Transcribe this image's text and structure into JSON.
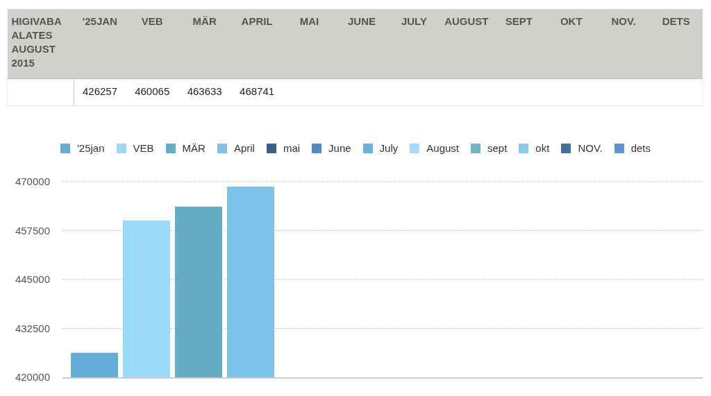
{
  "table": {
    "columns": [
      {
        "heading": "HIGIVABA ALATES AUGUST 2015"
      },
      {
        "heading": "'25JAN",
        "value": "426257"
      },
      {
        "heading": "VEB",
        "value": "460065"
      },
      {
        "heading": "MÄR",
        "value": "463633"
      },
      {
        "heading": "APRIL",
        "value": "468741"
      },
      {
        "heading": "MAI"
      },
      {
        "heading": "JUNE"
      },
      {
        "heading": "JULY"
      },
      {
        "heading": "AUGUST"
      },
      {
        "heading": "SEPT"
      },
      {
        "heading": "OKT"
      },
      {
        "heading": "NOV."
      },
      {
        "heading": "DETS"
      }
    ]
  },
  "chart": {
    "chart_data": {
      "type": "bar",
      "grid": true,
      "ylim": [
        420000,
        470000
      ],
      "yticks": [
        420000,
        432500,
        445000,
        457500,
        470000
      ],
      "series": [
        {
          "name": "'25jan",
          "color": "#63acd6",
          "values": [
            426257
          ]
        },
        {
          "name": "VEB",
          "color": "#99d9f9",
          "values": [
            460065
          ]
        },
        {
          "name": "MÄR",
          "color": "#65adc2",
          "values": [
            463633
          ]
        },
        {
          "name": "April",
          "color": "#7cc3ea",
          "values": [
            468741
          ]
        },
        {
          "name": "mai",
          "color": "#3a5f8e",
          "values": [
            null
          ]
        },
        {
          "name": "June",
          "color": "#4f88c6",
          "values": [
            null
          ]
        },
        {
          "name": "July",
          "color": "#67b3e0",
          "values": [
            null
          ]
        },
        {
          "name": "August",
          "color": "#a2dcf9",
          "values": [
            null
          ]
        },
        {
          "name": "sept",
          "color": "#6db6c6",
          "values": [
            null
          ]
        },
        {
          "name": "okt",
          "color": "#8ccceb",
          "values": [
            null
          ]
        },
        {
          "name": "NOV.",
          "color": "#466f9e",
          "values": [
            null
          ]
        },
        {
          "name": "dets",
          "color": "#5b96d2",
          "values": [
            null
          ]
        }
      ]
    }
  }
}
